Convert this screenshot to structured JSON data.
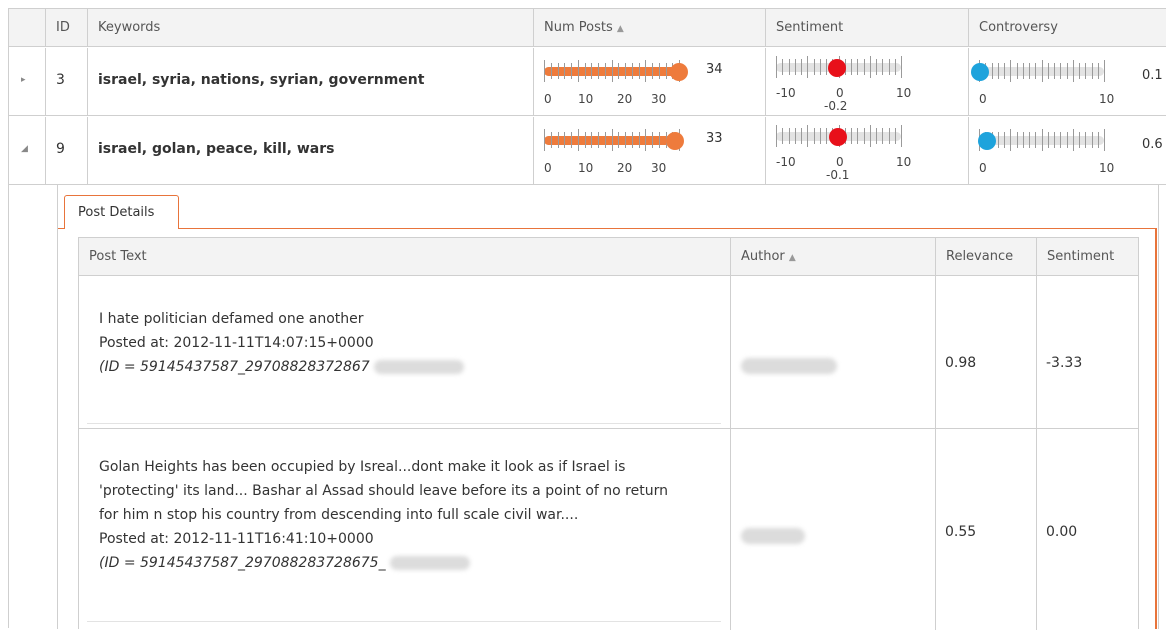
{
  "grid": {
    "columns": {
      "id": "ID",
      "keywords": "Keywords",
      "num_posts": "Num Posts",
      "num_posts_sort": "▲",
      "sentiment": "Sentiment",
      "controversy": "Controversy"
    },
    "rows": [
      {
        "toggle": "▸",
        "id": "3",
        "keywords": "israel, syria, nations, syrian, government",
        "num_posts": {
          "value": "34",
          "level": 34,
          "ticks": [
            "0",
            "10",
            "20",
            "30"
          ]
        },
        "sentiment": {
          "value": "-0.2",
          "level": -0.2,
          "ticks": [
            "-10",
            "0",
            "10"
          ]
        },
        "controversy": {
          "value": "0.1",
          "level": 0.1,
          "ticks": [
            "0",
            "10"
          ]
        }
      },
      {
        "toggle": "◢",
        "id": "9",
        "keywords": "israel, golan, peace, kill, wars",
        "num_posts": {
          "value": "33",
          "level": 33,
          "ticks": [
            "0",
            "10",
            "20",
            "30"
          ]
        },
        "sentiment": {
          "value": "-0.1",
          "level": -0.1,
          "ticks": [
            "-10",
            "0",
            "10"
          ]
        },
        "controversy": {
          "value": "0.6",
          "level": 0.6,
          "ticks": [
            "0",
            "10"
          ]
        }
      }
    ]
  },
  "details": {
    "tab_label": "Post Details",
    "columns": {
      "post_text": "Post Text",
      "author": "Author",
      "author_sort": "▲",
      "relevance": "Relevance",
      "sentiment": "Sentiment"
    },
    "posts": [
      {
        "lines": [
          "I hate politician defamed one another"
        ],
        "posted": "Posted at: 2012-11-11T14:07:15+0000",
        "id_text": "(ID = 59145437587_29708828372867",
        "relevance": "0.98",
        "sentiment": "-3.33"
      },
      {
        "lines": [
          "Golan Heights has been occupied by Isreal...dont make it look as if Israel is",
          "'protecting' its land... Bashar al Assad should leave before its a point of no return",
          "for him n stop his country from descending into full scale civil war...."
        ],
        "posted": "Posted at: 2012-11-11T16:41:10+0000",
        "id_text": "(ID = 59145437587_297088283728675_",
        "relevance": "0.55",
        "sentiment": "0.00"
      }
    ]
  },
  "colors": {
    "accent_orange": "#ee7b3c",
    "handle_red": "#e8101a",
    "handle_blue": "#1ea3dc",
    "border": "#cfcfcf",
    "header_bg": "#f3f3f3"
  }
}
